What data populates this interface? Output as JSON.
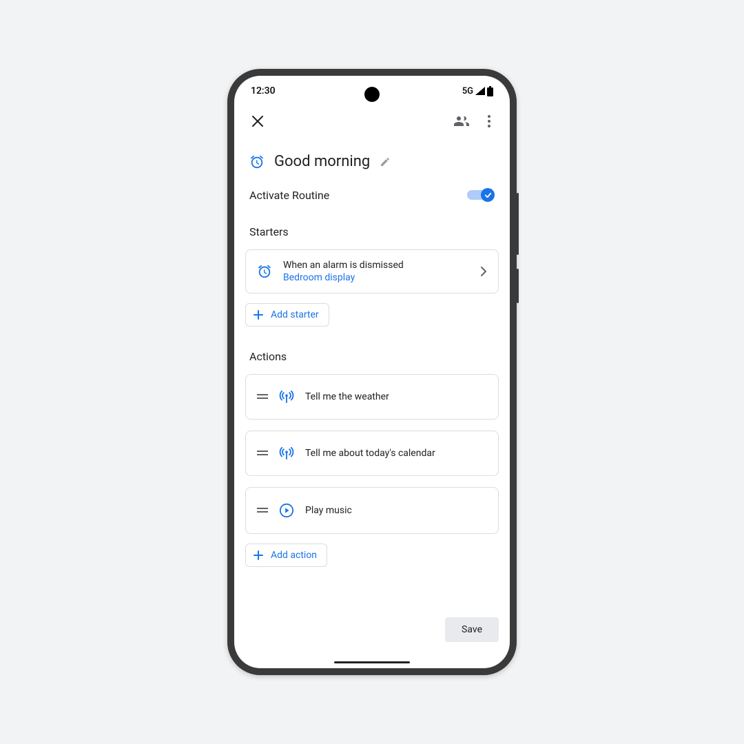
{
  "status_bar": {
    "time": "12:30",
    "network": "5G"
  },
  "routine": {
    "title": "Good morning",
    "activate_label": "Activate Routine",
    "activate_on": true
  },
  "sections": {
    "starters_label": "Starters",
    "actions_label": "Actions"
  },
  "starters": [
    {
      "primary": "When an alarm is dismissed",
      "secondary": "Bedroom display"
    }
  ],
  "actions": [
    {
      "label": "Tell me the weather",
      "icon": "broadcast"
    },
    {
      "label": "Tell me about today's calendar",
      "icon": "broadcast"
    },
    {
      "label": "Play music",
      "icon": "play"
    }
  ],
  "buttons": {
    "add_starter": "Add starter",
    "add_action": "Add action",
    "save": "Save"
  }
}
